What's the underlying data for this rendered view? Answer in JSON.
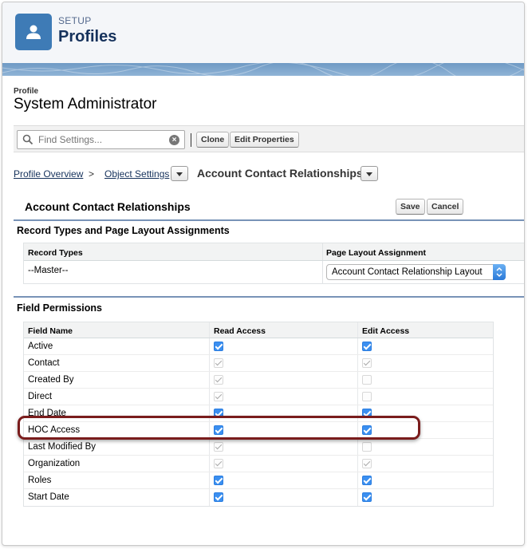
{
  "header": {
    "eyebrow": "SETUP",
    "title": "Profiles"
  },
  "profile": {
    "label": "Profile",
    "name": "System Administrator"
  },
  "toolbar": {
    "search_placeholder": "Find Settings...",
    "clone_label": "Clone",
    "edit_properties_label": "Edit Properties"
  },
  "breadcrumb": {
    "overview": "Profile Overview",
    "sep": ">",
    "object_settings": "Object Settings",
    "current": "Account Contact Relationships"
  },
  "object": {
    "title": "Account Contact Relationships",
    "save_label": "Save",
    "cancel_label": "Cancel"
  },
  "record_types": {
    "section_title": "Record Types and Page Layout Assignments",
    "col_record_types": "Record Types",
    "col_layout": "Page Layout Assignment",
    "row_name": "--Master--",
    "row_layout": "Account Contact Relationship Layout"
  },
  "field_permissions": {
    "section_title": "Field Permissions",
    "col_field": "Field Name",
    "col_read": "Read Access",
    "col_edit": "Edit Access",
    "rows": [
      {
        "name": "Active",
        "read": "on",
        "edit": "on"
      },
      {
        "name": "Contact",
        "read": "dis-checked",
        "edit": "dis-checked"
      },
      {
        "name": "Created By",
        "read": "dis-checked",
        "edit": "dis"
      },
      {
        "name": "Direct",
        "read": "dis-checked",
        "edit": "dis"
      },
      {
        "name": "End Date",
        "read": "on",
        "edit": "on"
      },
      {
        "name": "HOC Access",
        "read": "on",
        "edit": "on"
      },
      {
        "name": "Last Modified By",
        "read": "dis-checked",
        "edit": "dis"
      },
      {
        "name": "Organization",
        "read": "dis-checked",
        "edit": "dis-checked"
      },
      {
        "name": "Roles",
        "read": "on",
        "edit": "on"
      },
      {
        "name": "Start Date",
        "read": "on",
        "edit": "on"
      }
    ]
  },
  "colors": {
    "accent": "#3b8ff0",
    "header_icon": "#3e7bb6",
    "highlight": "#7a1c1c",
    "section_rule": "#7893b7"
  }
}
